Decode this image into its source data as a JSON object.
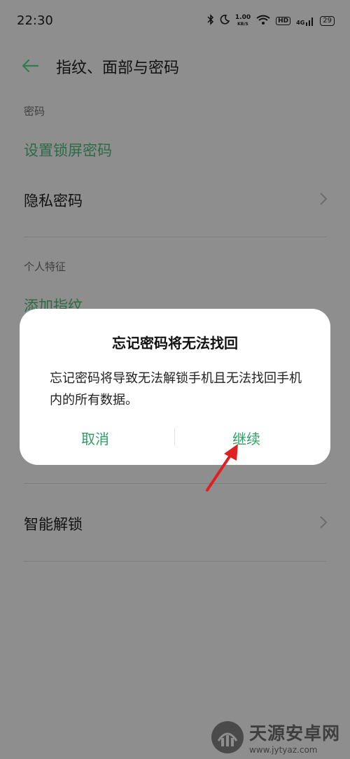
{
  "status_bar": {
    "time": "22:30",
    "net_speed_value": "1.00",
    "net_speed_unit": "KB/S",
    "hd": "HD",
    "signal": "4G",
    "battery": "29"
  },
  "header": {
    "title": "指纹、面部与密码"
  },
  "sections": {
    "password_label": "密码",
    "set_lock_password": "设置锁屏密码",
    "privacy_password": "隐私密码",
    "personal_label": "个人特征",
    "add_fingerprint": "添加指纹",
    "smart_unlock": "智能解锁"
  },
  "dialog": {
    "title": "忘记密码将无法找回",
    "message": "忘记密码将导致无法解锁手机且无法找回手机内的所有数据。",
    "cancel": "取消",
    "continue": "继续"
  },
  "watermark": {
    "name": "天源安卓网",
    "url": "www.jytyaz.com"
  },
  "colors": {
    "accent": "#2e9e64",
    "dim_overlay": "#8e8e8e",
    "annotation_arrow": "#e02020"
  }
}
